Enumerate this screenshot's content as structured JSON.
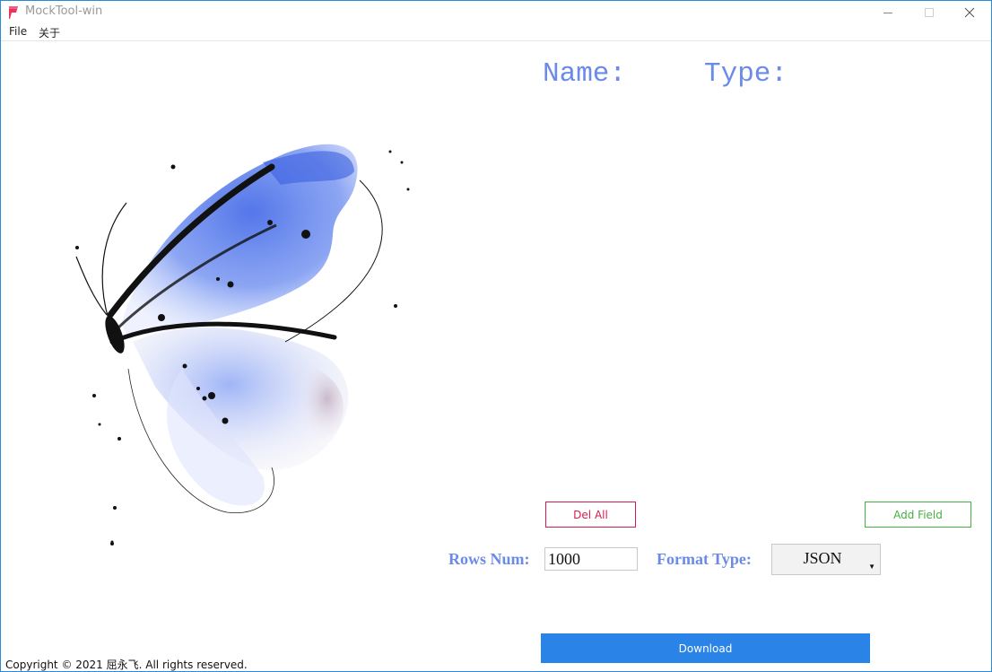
{
  "window": {
    "title": "MockTool-win"
  },
  "menu": {
    "items": [
      "File",
      "关于"
    ]
  },
  "fields": {
    "name_label": "Name:",
    "type_label": "Type:"
  },
  "actions": {
    "del_all_label": "Del All",
    "add_field_label": "Add Field",
    "download_label": "Download"
  },
  "form": {
    "rows_label": "Rows Num:",
    "rows_value": "1000",
    "format_label": "Format Type:",
    "format_value": "JSON"
  },
  "footer": {
    "copyright": "Copyright © 2021 屈永飞. All rights reserved."
  },
  "icons": {
    "app": "app-icon",
    "minimize": "minimize-icon",
    "maximize": "maximize-icon",
    "close": "close-icon",
    "dropdown": "chevron-down-icon"
  },
  "colors": {
    "accent_label": "#6b8be8",
    "delete": "#d81b4f",
    "add": "#44b044",
    "primary": "#2a83e6",
    "window_border": "#2b8ad8"
  }
}
